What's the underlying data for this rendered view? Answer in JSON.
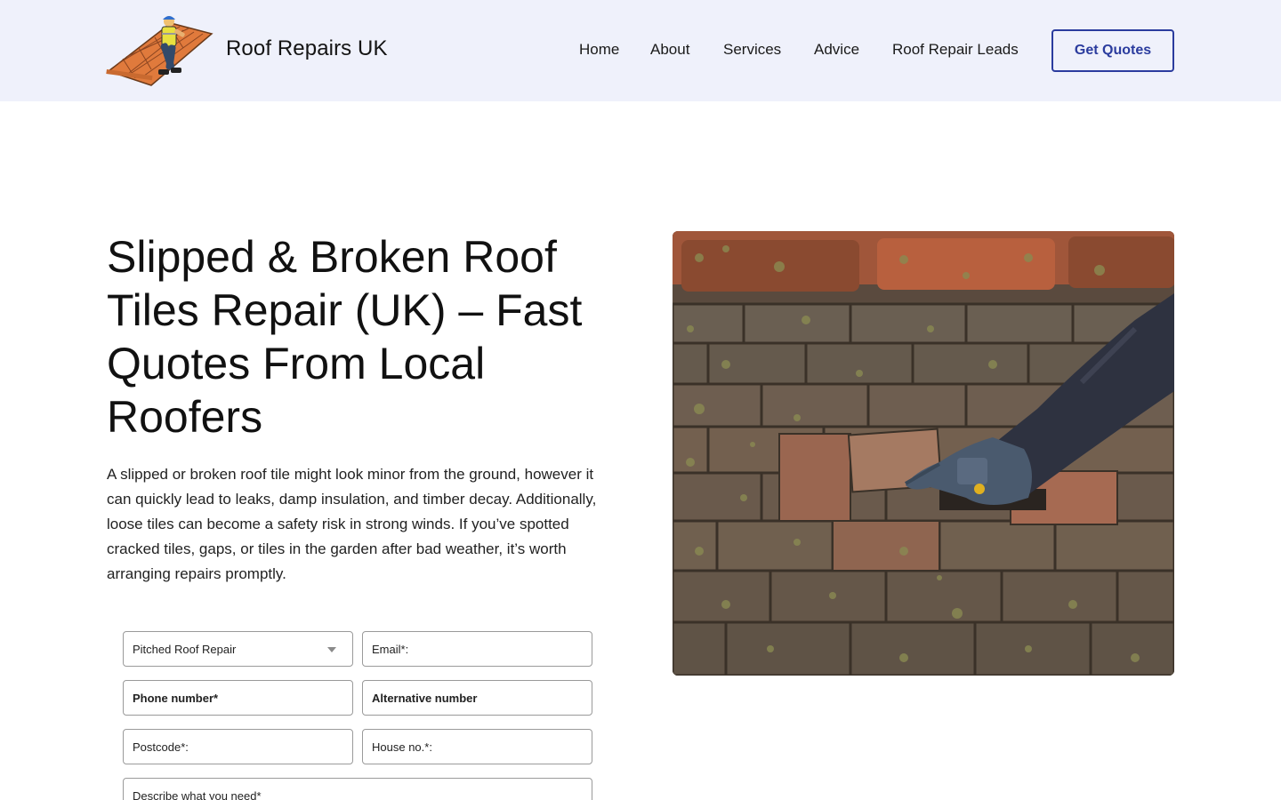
{
  "header": {
    "brand": "Roof Repairs UK",
    "nav": [
      "Home",
      "About",
      "Services",
      "Advice",
      "Roof Repair Leads"
    ],
    "cta_label": "Get Quotes"
  },
  "hero": {
    "title": "Slipped & Broken Roof Tiles Repair (UK) – Fast Quotes From Local Roofers",
    "text": "A slipped or broken roof tile might look minor from the ground, however it can quickly lead to leaks, damp insulation, and timber decay. Additionally, loose tiles can become a safety risk in strong winds. If you’ve spotted cracked tiles, gaps, or tiles in the garden after bad weather, it’s worth arranging repairs promptly."
  },
  "form": {
    "service_selected": "Pitched Roof Repair",
    "email_placeholder": "Email*:",
    "phone_placeholder": "Phone number*",
    "alt_placeholder": "Alternative number",
    "postcode_placeholder": "Postcode*:",
    "house_placeholder": "House no.*:",
    "describe_placeholder": "Describe what you need*"
  },
  "colors": {
    "header_bg": "#eff1fb",
    "accent": "#2b3c9e"
  }
}
